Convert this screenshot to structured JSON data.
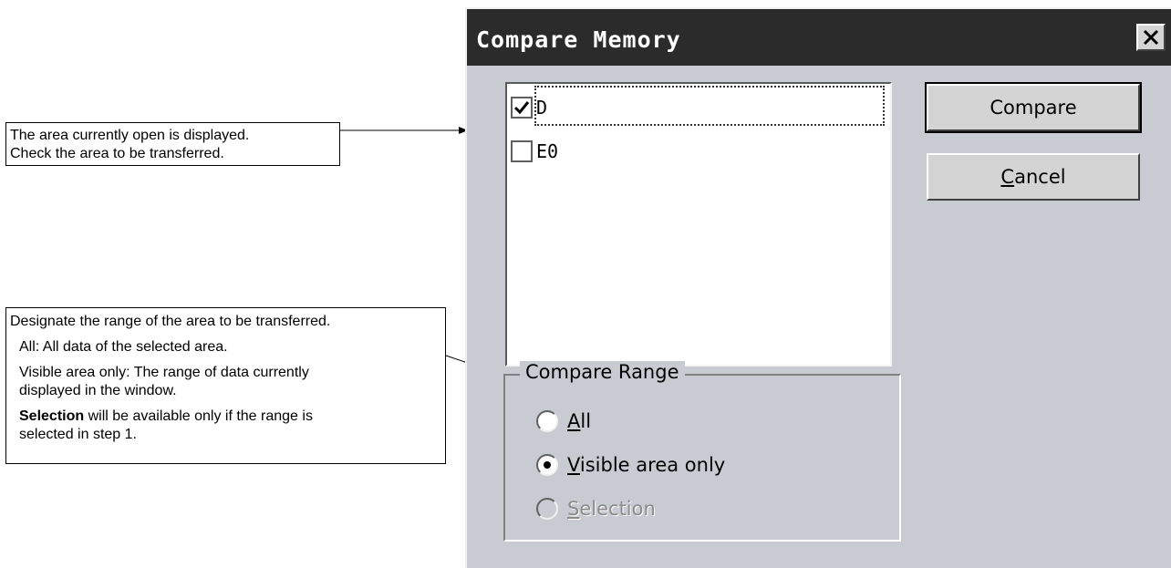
{
  "callouts": {
    "area": {
      "line1": "The area currently open is displayed.",
      "line2": "Check the area to be transferred."
    },
    "range": {
      "line1": "Designate the range of the area to be transferred.",
      "all": "All: All data of the selected area.",
      "visible_a": "Visible area only: The range of data currently",
      "visible_b": "displayed in the window.",
      "selection_bold": "Selection",
      "selection_rest": " will be available only if the range is",
      "selection_b": "selected in step 1."
    }
  },
  "dialog": {
    "title": "Compare Memory",
    "close_glyph": "✕",
    "areas": [
      {
        "label": "D",
        "checked": true
      },
      {
        "label": "E0",
        "checked": false
      }
    ],
    "buttons": {
      "compare": "Compare",
      "cancel_u": "C",
      "cancel_rest": "ancel"
    },
    "compare_range": {
      "title": "Compare Range",
      "options": [
        {
          "u": "A",
          "rest": "ll",
          "selected": false,
          "enabled": true
        },
        {
          "u": "V",
          "rest": "isible area only",
          "selected": true,
          "enabled": true
        },
        {
          "u": "S",
          "rest": "election",
          "selected": false,
          "enabled": false
        }
      ]
    }
  }
}
